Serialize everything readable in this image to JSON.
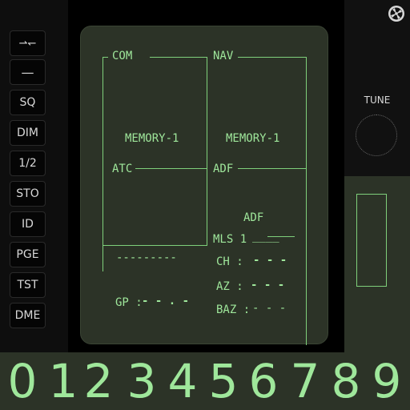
{
  "keys": {
    "swap": "⇀↽",
    "dash": "—",
    "sq": "SQ",
    "dim": "DIM",
    "half": "1/2",
    "sto": "STO",
    "id": "ID",
    "pge": "PGE",
    "tst": "TST",
    "dme": "DME"
  },
  "display": {
    "com_label": "COM",
    "nav_label": "NAV",
    "com_memory": "MEMORY-1",
    "nav_memory": "MEMORY-1",
    "atc_label": "ATC",
    "adf_label": "ADF",
    "adf_mode": "ADF",
    "mls_label": "MLS 1",
    "mls_value": "____",
    "dashes_line": "---------",
    "ch_label": "CH :",
    "ch_value": "- - -",
    "gp_label": "GP :",
    "gp_value": "- - . -",
    "az_label": "AZ :",
    "az_value": "- - -",
    "baz_label": "BAZ :",
    "baz_value": "- - -"
  },
  "right": {
    "tune_label": "TUNE"
  },
  "digits": [
    "0",
    "1",
    "2",
    "3",
    "4",
    "5",
    "6",
    "7",
    "8",
    "9"
  ],
  "colors": {
    "lcd_text": "#9fe79b",
    "lcd_background": "#2c3327"
  }
}
